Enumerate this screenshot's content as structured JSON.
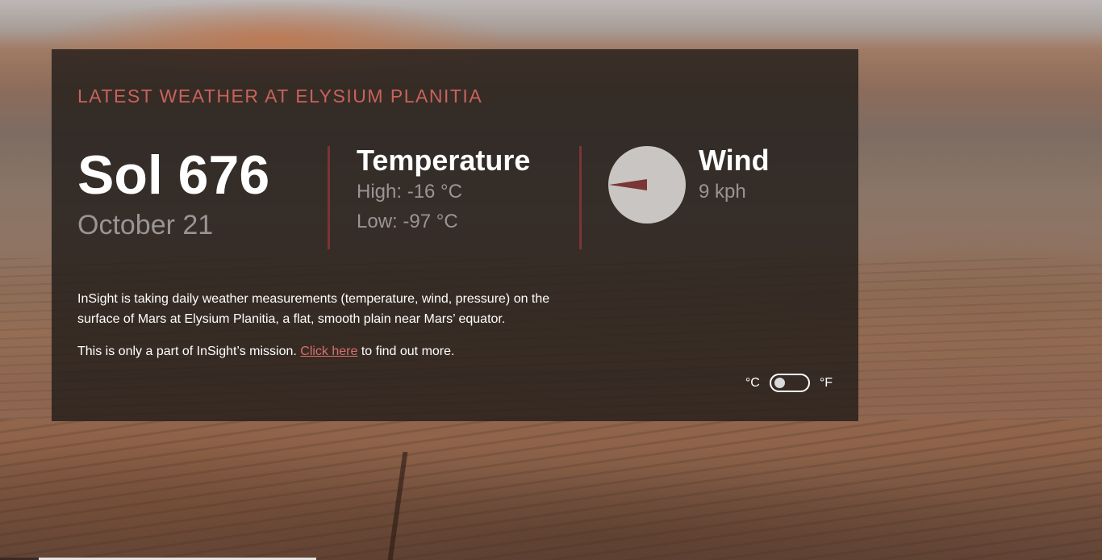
{
  "heading": "LATEST WEATHER AT ELYSIUM PLANITIA",
  "sol": {
    "title": "Sol 676",
    "date": "October 21"
  },
  "temperature": {
    "title": "Temperature",
    "high": "High: -16 °C",
    "low": "Low: -97 °C"
  },
  "wind": {
    "title": "Wind",
    "speed": "9 kph",
    "direction_icon": "wind-direction-dial",
    "dial_color": "#c9c5c3",
    "arrow_color": "#7a3534"
  },
  "description": {
    "paragraph1": "InSight is taking daily weather measurements (temperature, wind, pressure) on the surface of Mars at Elysium Planitia, a flat, smooth plain near Mars’ equator.",
    "paragraph2_prefix": "This is only a part of InSight’s mission. ",
    "link_text": "Click here",
    "paragraph2_suffix": " to find out more."
  },
  "units": {
    "celsius": "°C",
    "fahrenheit": "°F",
    "selected": "°C"
  },
  "colors": {
    "accent": "#c9625c",
    "divider": "#7a3534",
    "muted_text": "#9a9494"
  }
}
